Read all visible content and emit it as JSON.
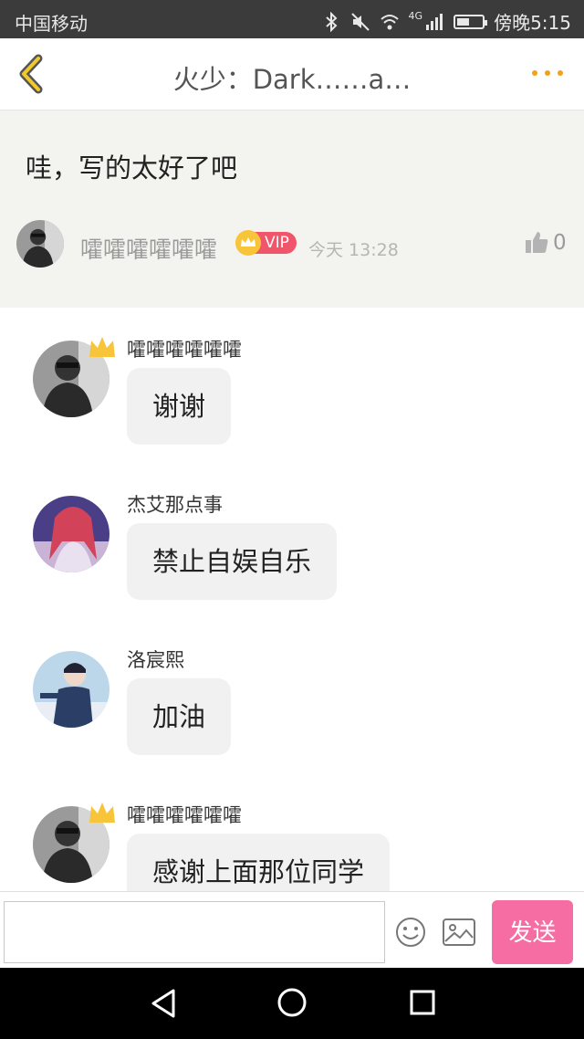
{
  "status_bar": {
    "carrier": "中国移动",
    "network": "4G",
    "time": "傍晚5:15",
    "battery_level": 0.5
  },
  "header": {
    "title": "火少：Dark……a…",
    "back_icon": "chevron-left-icon",
    "more_icon": "more-dots-icon",
    "accent_color": "#f0a21c"
  },
  "quoted_comment": {
    "text": "哇，写的太好了吧",
    "author": "嚯嚯嚯嚯嚯嚯",
    "vip_label": "VIP",
    "time": "今天 13:28",
    "likes": "0"
  },
  "replies": [
    {
      "author": "嚯嚯嚯嚯嚯嚯",
      "text": "谢谢",
      "crown": true,
      "avatar": "avatar-bw-girl"
    },
    {
      "author": "杰艾那点事",
      "text": "禁止自娱自乐",
      "crown": false,
      "avatar": "avatar-anime-pink"
    },
    {
      "author": "洛宸熙",
      "text": "加油",
      "crown": false,
      "avatar": "avatar-anime-boy"
    },
    {
      "author": "嚯嚯嚯嚯嚯嚯",
      "text": "感谢上面那位同学",
      "crown": true,
      "avatar": "avatar-bw-girl"
    }
  ],
  "input_bar": {
    "placeholder": "",
    "send_label": "发送",
    "send_color": "#f56da2",
    "emoji_icon": "smiley-icon",
    "image_icon": "image-icon"
  },
  "nav_bar": {
    "icons": [
      "triangle-back-icon",
      "circle-home-icon",
      "square-recent-icon"
    ]
  }
}
